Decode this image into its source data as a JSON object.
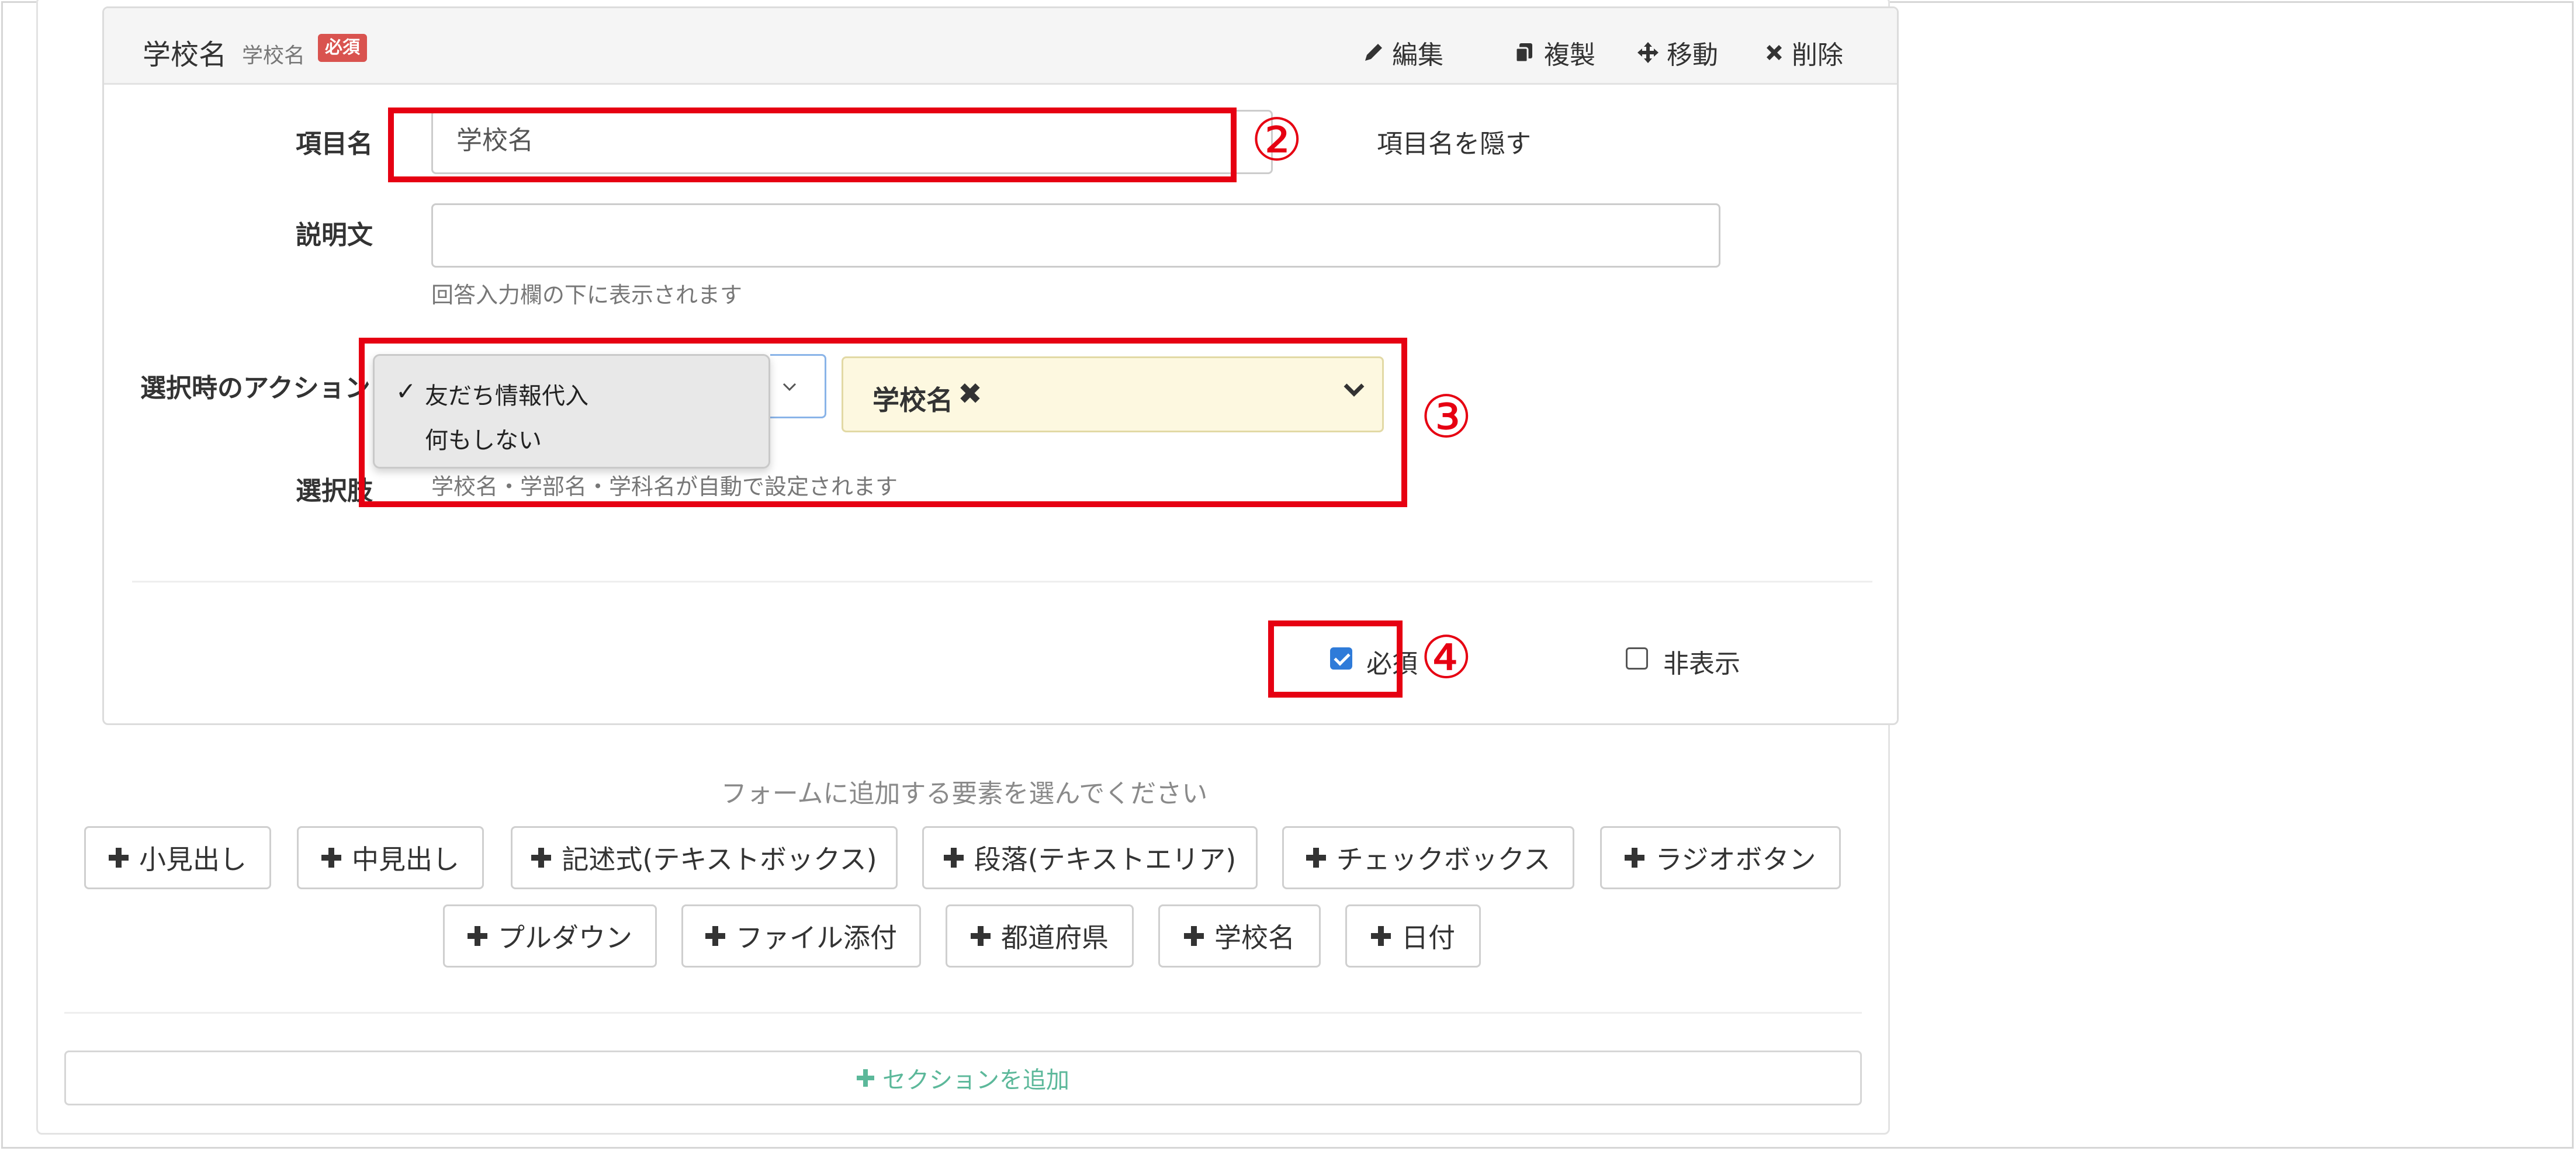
{
  "header": {
    "title": "学校名",
    "subtitle": "学校名",
    "badge": "必須",
    "actions": {
      "edit": "編集",
      "duplicate": "複製",
      "move": "移動",
      "delete": "削除"
    }
  },
  "form": {
    "item_name_label": "項目名",
    "item_name_value": "学校名",
    "hide_item_name_text": "項目名を隠す",
    "description_label": "説明文",
    "description_value": "",
    "description_help": "回答入力欄の下に表示されます",
    "action_label": "選択時のアクション",
    "action_options": [
      "友だち情報代入",
      "何もしない"
    ],
    "action_selected": "友だち情報代入",
    "target_tag": "学校名",
    "choices_label": "選択肢",
    "choices_help": "学校名・学部名・学科名が自動で設定されます",
    "required_label": "必須",
    "required_checked": true,
    "hidden_label": "非表示",
    "hidden_checked": false
  },
  "annotations": {
    "n2": "②",
    "n3": "③",
    "n4": "④",
    "color": "#e60012"
  },
  "add_elements": {
    "prompt": "フォームに追加する要素を選んでください",
    "buttons": [
      "小見出し",
      "中見出し",
      "記述式(テキストボックス)",
      "段落(テキストエリア)",
      "チェックボックス",
      "ラジオボタン",
      "プルダウン",
      "ファイル添付",
      "都道府県",
      "学校名",
      "日付"
    ]
  },
  "add_section_label": "セクションを追加"
}
